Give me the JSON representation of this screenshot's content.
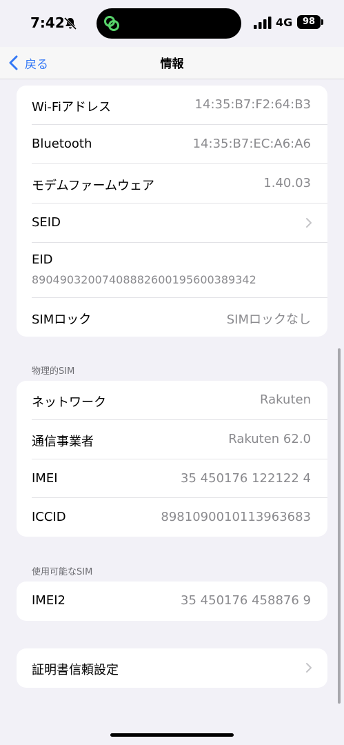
{
  "status_bar": {
    "time": "7:42",
    "network": "4G",
    "battery": "98",
    "icons": [
      "bell-slash-icon",
      "app-island-icon",
      "signal-bars-icon"
    ]
  },
  "nav": {
    "back_label": "戻る",
    "title": "情報"
  },
  "info_group": {
    "wifi_label": "Wi-Fiアドレス",
    "wifi_value": "14:35:B7:F2:64:B3",
    "bluetooth_label": "Bluetooth",
    "bluetooth_value": "14:35:B7:EC:A6:A6",
    "modem_label": "モデムファームウェア",
    "modem_value": "1.40.03",
    "seid_label": "SEID",
    "eid_label": "EID",
    "eid_value": "89049032007408882600195600389342",
    "simlock_label": "SIMロック",
    "simlock_value": "SIMロックなし"
  },
  "physical_sim": {
    "header": "物理的SIM",
    "network_label": "ネットワーク",
    "network_value": "Rakuten",
    "carrier_label": "通信事業者",
    "carrier_value": "Rakuten 62.0",
    "imei_label": "IMEI",
    "imei_value": "35 450176 122122 4",
    "iccid_label": "ICCID",
    "iccid_value": "8981090010113963683"
  },
  "available_sim": {
    "header": "使用可能なSIM",
    "imei2_label": "IMEI2",
    "imei2_value": "35 450176 458876 9"
  },
  "cert_group": {
    "label": "証明書信頼設定"
  },
  "colors": {
    "accent": "#3478f6",
    "background": "#f2f1f7",
    "secondary_text": "#8a8a8e"
  }
}
